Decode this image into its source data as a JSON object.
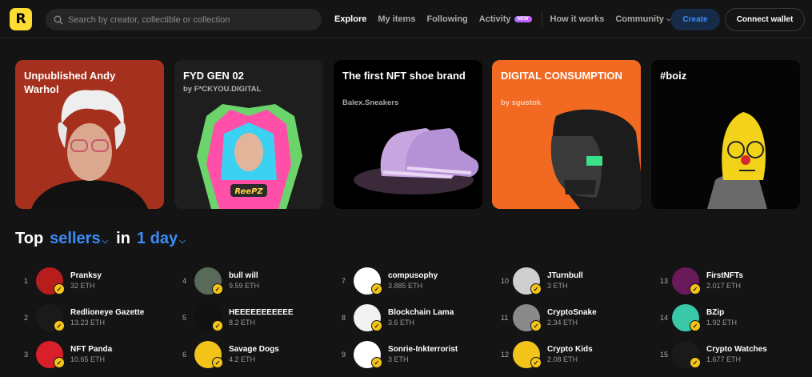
{
  "header": {
    "logo": "R",
    "search_placeholder": "Search by creator, collectible or collection",
    "nav": [
      {
        "label": "Explore",
        "active": true
      },
      {
        "label": "My items"
      },
      {
        "label": "Following"
      },
      {
        "label": "Activity",
        "badge": "NEW"
      }
    ],
    "nav_right": [
      {
        "label": "How it works"
      },
      {
        "label": "Community"
      }
    ],
    "create_label": "Create",
    "wallet_label": "Connect wallet"
  },
  "featured": [
    {
      "title": "Unpublished Andy Warhol",
      "subtitle": "",
      "bg": "#a4301d"
    },
    {
      "title": "FYD GEN 02",
      "subtitle": "by F*CKYOU.DIGITAL",
      "bg": "#1e1e1e"
    },
    {
      "title": "The first NFT shoe brand",
      "subtitle": "Balex.Sneakers",
      "bg": "#000000"
    },
    {
      "title": "DIGITAL CONSUMPTION",
      "subtitle": "by sgustok",
      "bg": "#f26a22"
    },
    {
      "title": "#boiz",
      "subtitle": "",
      "bg": "#050505"
    }
  ],
  "top_sellers": {
    "title_prefix": "Top",
    "title_filter": "sellers",
    "title_mid": "in",
    "title_period": "1 day",
    "sellers": [
      {
        "rank": "1",
        "name": "Pranksy",
        "eth": "32 ETH",
        "color": "#b81d1d"
      },
      {
        "rank": "2",
        "name": "Redlioneye Gazette",
        "eth": "13.23 ETH",
        "color": "#1a1a1a"
      },
      {
        "rank": "3",
        "name": "NFT Panda",
        "eth": "10.65 ETH",
        "color": "#d81f2a"
      },
      {
        "rank": "4",
        "name": "bull will",
        "eth": "9.59 ETH",
        "color": "#5a6a5a"
      },
      {
        "rank": "5",
        "name": "HEEEEEEEEEEE",
        "eth": "8.2 ETH",
        "color": "#111111"
      },
      {
        "rank": "6",
        "name": "Savage Dogs",
        "eth": "4.2 ETH",
        "color": "#f2c41a"
      },
      {
        "rank": "7",
        "name": "compusophy",
        "eth": "3.885 ETH",
        "color": "#ffffff"
      },
      {
        "rank": "8",
        "name": "Blockchain Lama",
        "eth": "3.6 ETH",
        "color": "#f2f2f2"
      },
      {
        "rank": "9",
        "name": "Sonrie-Inkterrorist",
        "eth": "3 ETH",
        "color": "#ffffff"
      },
      {
        "rank": "10",
        "name": "JTurnbull",
        "eth": "3 ETH",
        "color": "#cfcfcf"
      },
      {
        "rank": "11",
        "name": "CryptoSnake",
        "eth": "2.34 ETH",
        "color": "#8a8a8a"
      },
      {
        "rank": "12",
        "name": "Crypto Kids",
        "eth": "2.08 ETH",
        "color": "#f2c41a"
      },
      {
        "rank": "13",
        "name": "FirstNFTs",
        "eth": "2.017 ETH",
        "color": "#6a1a5a"
      },
      {
        "rank": "14",
        "name": "BZip",
        "eth": "1.92 ETH",
        "color": "#3ac9a8"
      },
      {
        "rank": "15",
        "name": "Crypto Watches",
        "eth": "1.677 ETH",
        "color": "#1a1a1a"
      }
    ]
  }
}
